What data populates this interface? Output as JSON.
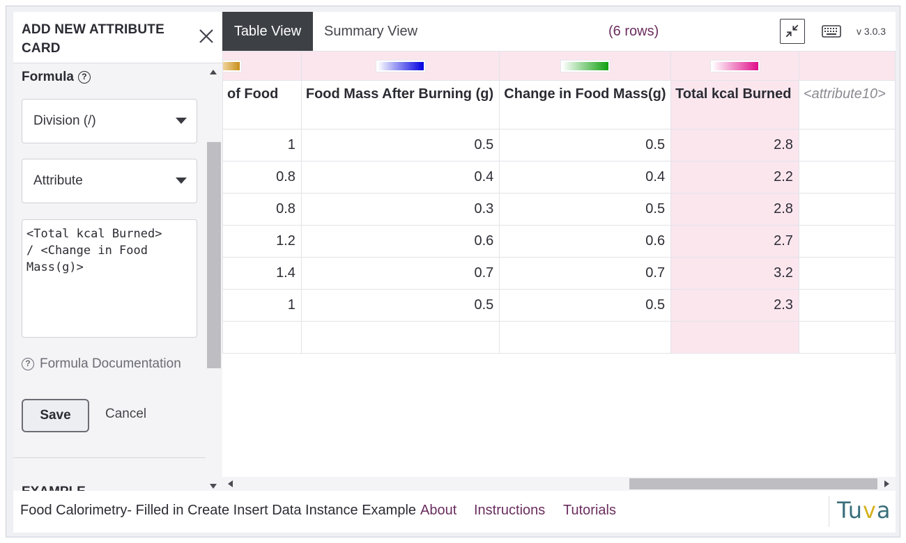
{
  "panel": {
    "title": "ADD NEW ATTRIBUTE CARD",
    "formula_label": "Formula",
    "help_glyph": "?",
    "operator_value": "Division (/)",
    "attribute_value": "Attribute",
    "formula_text": "<Total kcal Burned>\n/ <Change in Food\nMass(g)>",
    "doc_link": "Formula Documentation",
    "save_label": "Save",
    "cancel_label": "Cancel",
    "example_label": "EXAMPLE"
  },
  "topbar": {
    "tab_table": "Table View",
    "tab_summary": "Summary View",
    "row_count": "(6 rows)",
    "version": "v 3.0.3"
  },
  "table": {
    "columns": [
      {
        "header": "of Food",
        "swatch": "linear-gradient(90deg,#f3d9a8,#c8901a)"
      },
      {
        "header": "Food Mass After Burning (g)",
        "swatch": "linear-gradient(90deg,#ffffff,#0000e0)"
      },
      {
        "header": "Change in Food Mass(g)",
        "swatch": "linear-gradient(90deg,#ffffff,#10a010)"
      },
      {
        "header": "Total kcal Burned",
        "swatch": "linear-gradient(90deg,#ffffff,#e0108a)"
      },
      {
        "header": "<attribute10>",
        "swatch": ""
      }
    ],
    "rows": [
      [
        "1",
        "0.5",
        "0.5",
        "2.8",
        ""
      ],
      [
        "0.8",
        "0.4",
        "0.4",
        "2.2",
        ""
      ],
      [
        "0.8",
        "0.3",
        "0.5",
        "2.8",
        ""
      ],
      [
        "1.2",
        "0.6",
        "0.6",
        "2.7",
        ""
      ],
      [
        "1.4",
        "0.7",
        "0.7",
        "3.2",
        ""
      ],
      [
        "1",
        "0.5",
        "0.5",
        "2.3",
        ""
      ]
    ],
    "highlight_color": "#fbe6ee"
  },
  "footer": {
    "title": "Food Calorimetry- Filled in Create Insert Data Instance Example",
    "about": "About",
    "instructions": "Instructions",
    "tutorials": "Tutorials",
    "logo_prefix": "Tu",
    "logo_v": "v",
    "logo_suffix": "a"
  },
  "icons": {
    "close": "close-icon",
    "help": "help-circle-icon",
    "collapse": "collapse-arrows-icon",
    "keyboard": "keyboard-icon"
  }
}
